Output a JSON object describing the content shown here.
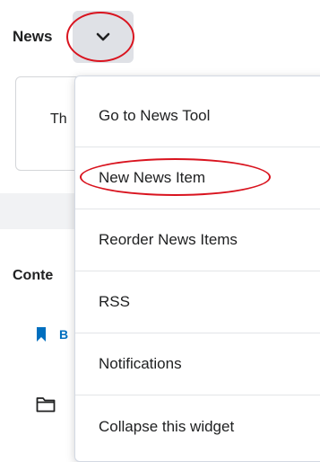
{
  "widget": {
    "title": "News",
    "card_text": "Th"
  },
  "content": {
    "title": "Conte",
    "bookmark_text": "B"
  },
  "menu": {
    "items": [
      {
        "label": "Go to News Tool"
      },
      {
        "label": "New News Item"
      },
      {
        "label": "Reorder News Items"
      },
      {
        "label": "RSS"
      },
      {
        "label": "Notifications"
      },
      {
        "label": "Collapse this widget"
      }
    ]
  },
  "colors": {
    "accent_blue": "#006fbf",
    "highlight_red": "#d9141f"
  },
  "icons": {
    "widget_menu": "chevron-down-icon",
    "bookmark": "bookmark-icon",
    "folder": "folder-icon"
  }
}
